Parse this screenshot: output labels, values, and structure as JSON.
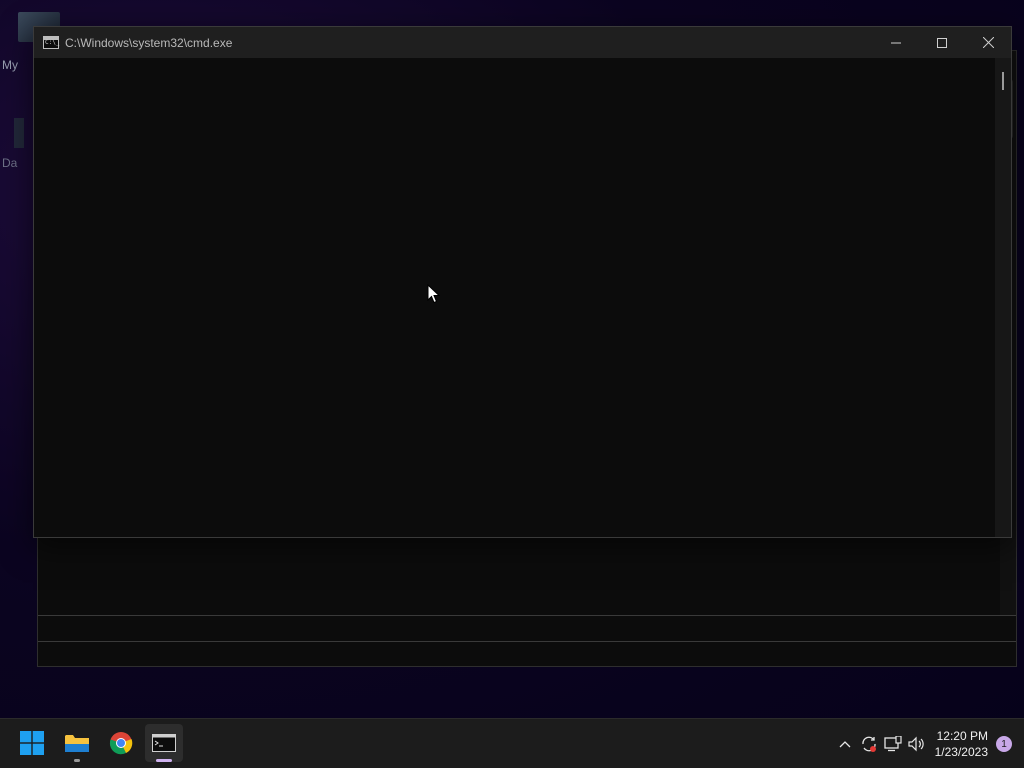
{
  "desktop": {
    "icon_label_partial_1": "My",
    "icon_label_partial_2": "Da"
  },
  "cmd_window": {
    "title": "C:\\Windows\\system32\\cmd.exe",
    "minimize_glyph": "—",
    "maximize_glyph": "☐",
    "close_glyph": "✕"
  },
  "taskbar": {
    "apps": [
      {
        "name": "Start",
        "icon": "windows-logo-icon"
      },
      {
        "name": "File Explorer",
        "icon": "folder-icon"
      },
      {
        "name": "Google Chrome",
        "icon": "chrome-icon"
      },
      {
        "name": "Command Prompt",
        "icon": "terminal-icon",
        "active": true
      }
    ],
    "tray": {
      "overflow_icon": "chevron-up-icon",
      "sync_icon": "sync-icon",
      "network_icon": "network-icon",
      "volume_icon": "volume-icon"
    },
    "time": "12:20 PM",
    "date": "1/23/2023",
    "notification_count": "1"
  },
  "colors": {
    "accent_start": "#1ea0f0",
    "indicator_active": "#d0b3f0",
    "console_bg": "#0c0c0c"
  }
}
